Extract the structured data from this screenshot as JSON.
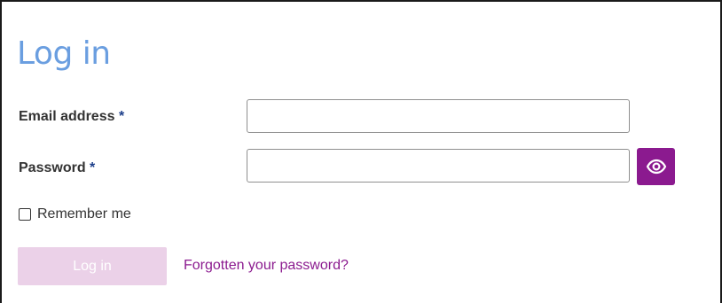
{
  "form": {
    "title": "Log in",
    "email": {
      "label": "Email address",
      "required_marker": "*",
      "value": "",
      "placeholder": ""
    },
    "password": {
      "label": "Password",
      "required_marker": "*",
      "value": "",
      "placeholder": "",
      "toggle_icon": "eye-icon"
    },
    "remember": {
      "label": "Remember me",
      "checked": false
    },
    "submit_label": "Log in",
    "forgot_link": "Forgotten your password?"
  },
  "colors": {
    "title": "#6a9ee0",
    "accent": "#8b1a8f",
    "submit_disabled_bg": "#ebd1e8",
    "required_marker": "#1c3e8a"
  }
}
